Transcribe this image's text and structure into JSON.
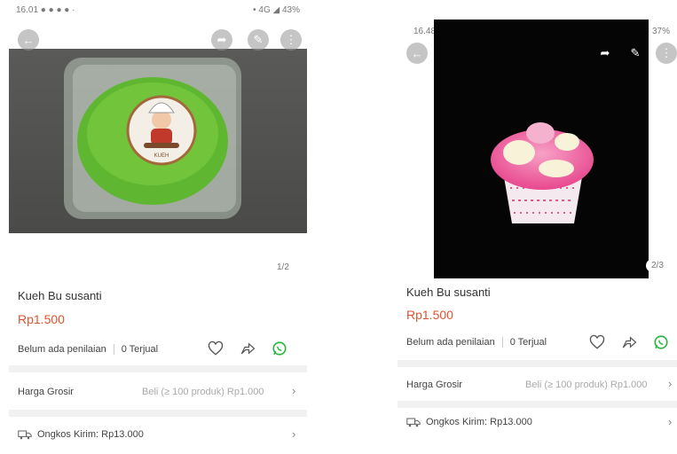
{
  "left": {
    "status_time": "16.01 ● ● ● ● ·",
    "status_right": "• 4G ◢ 43%",
    "counter": "1/2",
    "product_name": "Kueh Bu susanti",
    "price": "Rp1.500",
    "rating_text": "Belum ada penilaian",
    "sold_text": "0 Terjual",
    "wholesale_label": "Harga Grosir",
    "wholesale_value": "Beli (≥ 100 produk) Rp1.000",
    "shipping_label": "Ongkos Kirim: Rp13.000"
  },
  "right": {
    "status_time": "16.48",
    "status_right": "37%",
    "counter": "2/3",
    "product_name": "Kueh Bu susanti",
    "price": "Rp1.500",
    "rating_text": "Belum ada penilaian",
    "sold_text": "0 Terjual",
    "wholesale_label": "Harga Grosir",
    "wholesale_value": "Beli (≥ 100 produk) Rp1.000",
    "shipping_label": "Ongkos Kirim: Rp13.000"
  },
  "colors": {
    "price": "#e2522e",
    "whatsapp": "#2bb741",
    "kueh_green": "#5fb731",
    "kueh_pink": "#ef5fa0"
  },
  "icons": [
    "back-arrow-icon",
    "share-icon",
    "edit-icon",
    "more-icon",
    "heart-icon",
    "whatsapp-icon",
    "truck-icon",
    "chevron-right-icon"
  ]
}
